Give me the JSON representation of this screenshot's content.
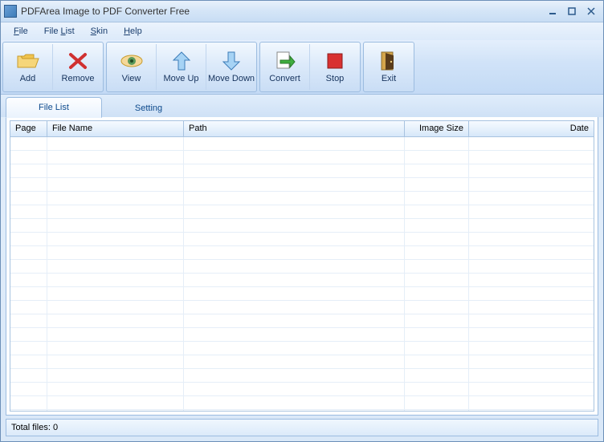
{
  "window": {
    "title": "PDFArea Image to PDF Converter Free"
  },
  "menu": {
    "file": "File",
    "filelist": "File List",
    "skin": "Skin",
    "help": "Help"
  },
  "toolbar": {
    "add": "Add",
    "remove": "Remove",
    "view": "View",
    "moveup": "Move Up",
    "movedown": "Move Down",
    "convert": "Convert",
    "stop": "Stop",
    "exit": "Exit"
  },
  "tabs": {
    "filelist": "File List",
    "setting": "Setting"
  },
  "columns": {
    "page": "Page",
    "filename": "File Name",
    "path": "Path",
    "imagesize": "Image Size",
    "date": "Date"
  },
  "status": {
    "total": "Total files: 0"
  }
}
